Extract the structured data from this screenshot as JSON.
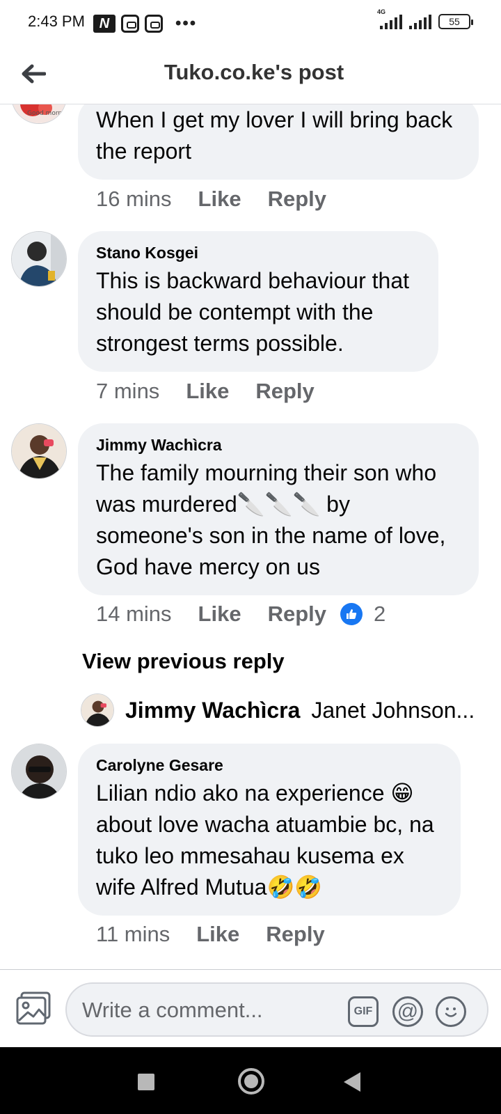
{
  "status_bar": {
    "time": "2:43 PM",
    "net_label": "4G",
    "battery": "55",
    "notification_icons": [
      "netflix-icon",
      "app-icon",
      "app-icon"
    ],
    "more": "•••"
  },
  "header": {
    "title": "Tuko.co.ke's post"
  },
  "comments": [
    {
      "author": "",
      "text": "When I get my lover I will bring back the report",
      "time": "16 mins",
      "like_label": "Like",
      "reply_label": "Reply",
      "avatar_caption": "Good morni"
    },
    {
      "author": "Stano Kosgei",
      "text": "This is backward behaviour that should be contempt with the strongest terms possible.",
      "time": "7 mins",
      "like_label": "Like",
      "reply_label": "Reply"
    },
    {
      "author": "Jimmy Wachìcra",
      "text_before": "The family mourning their son who was murdered",
      "emoji": "🔪🔪🔪",
      "text_after": " by someone's son in the  name of love, God have mercy on us",
      "time": "14 mins",
      "like_label": "Like",
      "reply_label": "Reply",
      "reaction_count": "2",
      "view_previous": "View previous reply",
      "latest_reply": {
        "author": "Jimmy Wachìcra",
        "snippet": "Janet Johnson..."
      }
    },
    {
      "author": "Carolyne Gesare",
      "text_1": "Lilian ndio ako na experience ",
      "emoji_1": "😁",
      "text_2": " about love wacha atuambie bc, na tuko leo mmesahau kusema ex wife Alfred Mutua",
      "emoji_2": "🤣🤣",
      "time": "11 mins",
      "like_label": "Like",
      "reply_label": "Reply"
    }
  ],
  "composer": {
    "placeholder": "Write a comment...",
    "gif_label": "GIF",
    "mention_label": "@"
  },
  "colors": {
    "bubble": "#f0f2f5",
    "meta_text": "#65676b",
    "like_blue": "#1877f2"
  }
}
